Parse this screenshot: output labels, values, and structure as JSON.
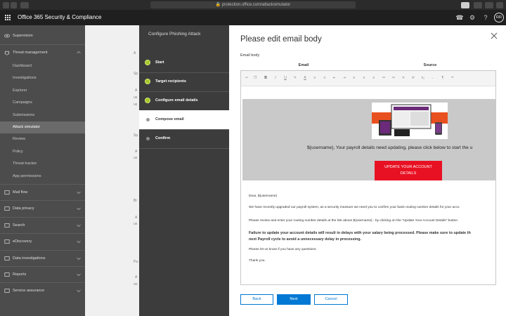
{
  "browser": {
    "url": "protection.office.com/attacksimulator"
  },
  "app": {
    "title": "Office 365 Security & Compliance",
    "avatar_initials": "RR"
  },
  "sidebar": {
    "supervision": "Supervision",
    "threat_management": "Threat management",
    "threat_items": [
      "Dashboard",
      "Investigations",
      "Explorer",
      "Campaigns",
      "Submissions",
      "Attack simulator",
      "Review",
      "Policy",
      "Threat tracker",
      "App permissions"
    ],
    "active_item": "Attack simulator",
    "sections": [
      "Mail flow",
      "Data privacy",
      "Search",
      "eDiscovery",
      "Data investigations",
      "Reports",
      "Service assurance"
    ]
  },
  "background": {
    "letters": [
      "A",
      "Sp",
      "A",
      "Sp",
      "A",
      "Br",
      "A",
      "Pa",
      "A"
    ],
    "words": [
      "us",
      "us",
      "us",
      "on",
      "us"
    ]
  },
  "wizard": {
    "title": "Configure Phishing Attack",
    "steps": [
      {
        "label": "Start",
        "state": "done"
      },
      {
        "label": "Target recipients",
        "state": "done"
      },
      {
        "label": "Configure email details",
        "state": "done"
      },
      {
        "label": "Compose email",
        "state": "current"
      },
      {
        "label": "Confirm",
        "state": "pending"
      }
    ]
  },
  "panel": {
    "title": "Please edit email body",
    "email_body_label": "Email body",
    "tabs": [
      "Email",
      "Source"
    ]
  },
  "email": {
    "banner_text": "${username}, Your payroll details need updating, please click below to start the u",
    "button_line1": "UPDATE YOUR ACCOUNT",
    "button_line2": "DETAILS",
    "greeting": "Dear, ${username}",
    "p1": "We have recently upgraded our payroll system, as a security measure we need you to confirm your bank routing number details for your acco",
    "p2": "Please review and enter your routing number details at the link above ${username} - by clicking on the \"Update Your Account Details\" button",
    "p3_line1": "Failure to update your account details will result in delays with your salary being processed. Please make sure to update th",
    "p3_line2": "next Payroll cycle to avoid a unnecessary delay in processing.",
    "p4": "Please let us know if you have any questions.",
    "signoff": "Thank you."
  },
  "footer": {
    "back": "Back",
    "next": "Next",
    "cancel": "Cancel"
  },
  "colors": {
    "accent": "#0078d4",
    "danger": "#e81123",
    "step_done": "#a6c729"
  }
}
